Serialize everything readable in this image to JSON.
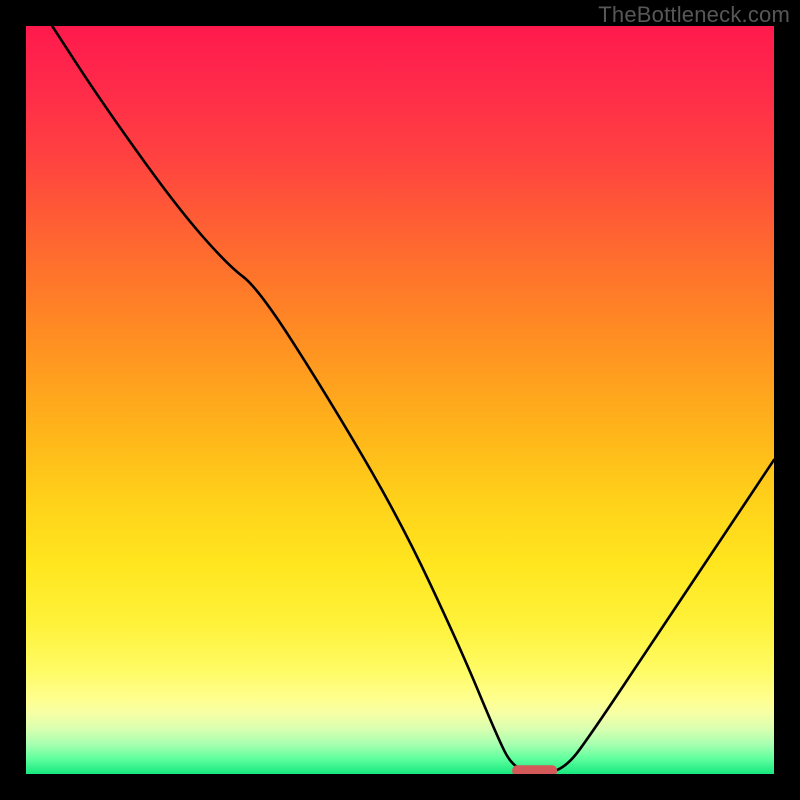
{
  "watermark": "TheBottleneck.com",
  "chart_data": {
    "type": "line",
    "title": "",
    "xlabel": "",
    "ylabel": "",
    "xlim": [
      0,
      100
    ],
    "ylim": [
      0,
      100
    ],
    "grid": false,
    "legend": false,
    "marker": {
      "x": 68,
      "y": 0.5,
      "width": 6,
      "color": "#d45a5a",
      "shape": "rounded"
    },
    "series": [
      {
        "name": "bottleneck-curve",
        "color": "#000000",
        "points": [
          {
            "x": 3.5,
            "y": 100
          },
          {
            "x": 10,
            "y": 90
          },
          {
            "x": 20,
            "y": 76
          },
          {
            "x": 27,
            "y": 68
          },
          {
            "x": 31,
            "y": 65
          },
          {
            "x": 40,
            "y": 51
          },
          {
            "x": 50,
            "y": 34
          },
          {
            "x": 58,
            "y": 17
          },
          {
            "x": 63,
            "y": 5
          },
          {
            "x": 65,
            "y": 1
          },
          {
            "x": 68,
            "y": 0
          },
          {
            "x": 72,
            "y": 0.5
          },
          {
            "x": 76,
            "y": 6
          },
          {
            "x": 84,
            "y": 18
          },
          {
            "x": 92,
            "y": 30
          },
          {
            "x": 100,
            "y": 42
          }
        ]
      }
    ]
  }
}
